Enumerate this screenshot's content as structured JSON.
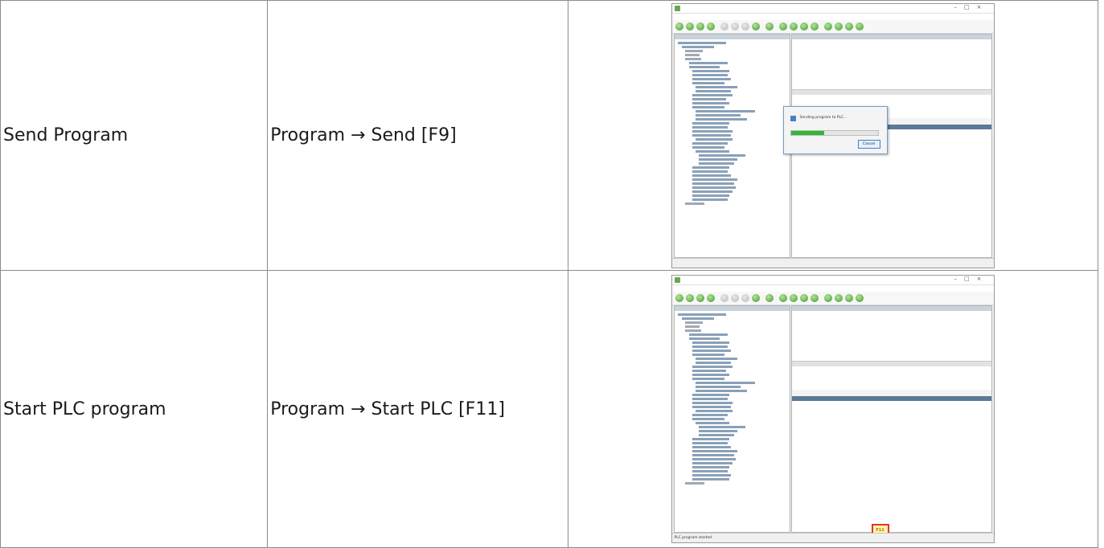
{
  "rows": [
    {
      "action": "Send Program",
      "menu_path": "Program → Send [F9]"
    },
    {
      "action": "Start PLC program",
      "menu_path": "Program → Start PLC [F11]"
    }
  ],
  "thumbnails": {
    "send": {
      "dialog_message": "Sending program to PLC...",
      "cancel_label": "Cancel",
      "progress_fraction": 0.38
    },
    "start": {
      "key_highlight": "F11",
      "status_text": "PLC program started"
    }
  },
  "colors": {
    "table_border": "#8c8c8c",
    "highlight_border": "#e53030",
    "progress_fill": "#33b733",
    "toolbar_icon": "#3d9a2a"
  }
}
